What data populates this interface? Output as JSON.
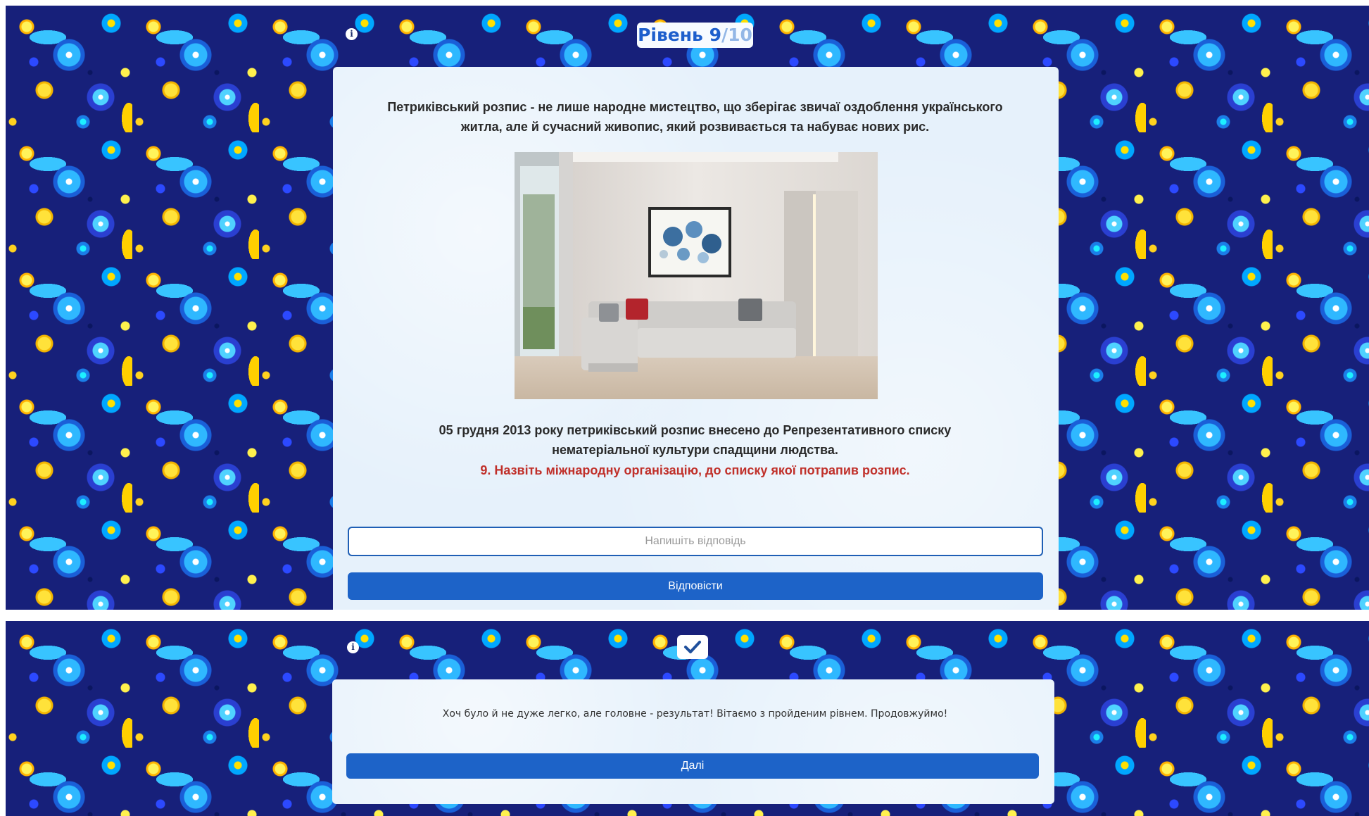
{
  "question_screen": {
    "info_icon": "info-icon",
    "level": {
      "prefix": "Рівень",
      "current": "9",
      "separator": "/",
      "total": "10"
    },
    "intro_text": "Петриківський розпис - не лише народне мистецтво, що зберігає звичаї оздоблення українського житла, але й сучасний живопис, який розвивається та набуває нових рис.",
    "fact_text": "05 грудня 2013 року петриківський розпис внесено до Репрезентативного списку нематеріальної культури спадщини людства.",
    "question_text": "9. Назвіть міжнародну організацію, до списку якої потрапив розпис.",
    "answer_input": {
      "placeholder": "Напишіть відповідь",
      "value": ""
    },
    "submit_label": "Відповісти"
  },
  "result_screen": {
    "info_icon": "info-icon",
    "status_icon": "checkmark-icon",
    "message": "Хоч було й не дуже легко, але головне - результат! Вітаємо з пройденим рівнем. Продовжуймо!",
    "next_label": "Далі"
  },
  "colors": {
    "accent": "#1d63c8",
    "question": "#c0302a",
    "pattern_base": "#17207a",
    "card": "#e6f1fb"
  }
}
